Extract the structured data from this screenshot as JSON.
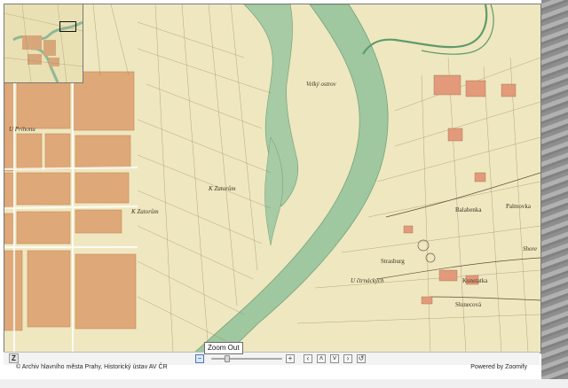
{
  "map": {
    "labels": {
      "velky_ostrov": "Velký ostrov",
      "u_prihonu": "U Prihonu",
      "k_zatorum_1": "K Zatorům",
      "k_zatorum_2": "K Zatorům",
      "balabenka": "Balabenka",
      "palmovka": "Palmovka",
      "straburg": "Strasburg",
      "kunstatka": "Kunstatka",
      "u_ctrnacki": "U čtrnáckých",
      "slunecova": "Slunecová",
      "shore": "Shore"
    }
  },
  "toolbar": {
    "logo": "Z",
    "zoom_out": "−",
    "zoom_in": "+",
    "pan_left": "‹",
    "pan_up": "˄",
    "pan_down": "˅",
    "pan_right": "›",
    "reset": "↺",
    "zoom_level": 0.2
  },
  "tooltip": "Zoom Out",
  "footer": {
    "copyright": "© Archiv hlavního města Prahy, Historický ústav AV ČR",
    "powered": "Powered by Zoomify"
  },
  "colors": {
    "river": "#9fc7a0",
    "land": "#efe7bf",
    "parcel": "#dfa878"
  }
}
